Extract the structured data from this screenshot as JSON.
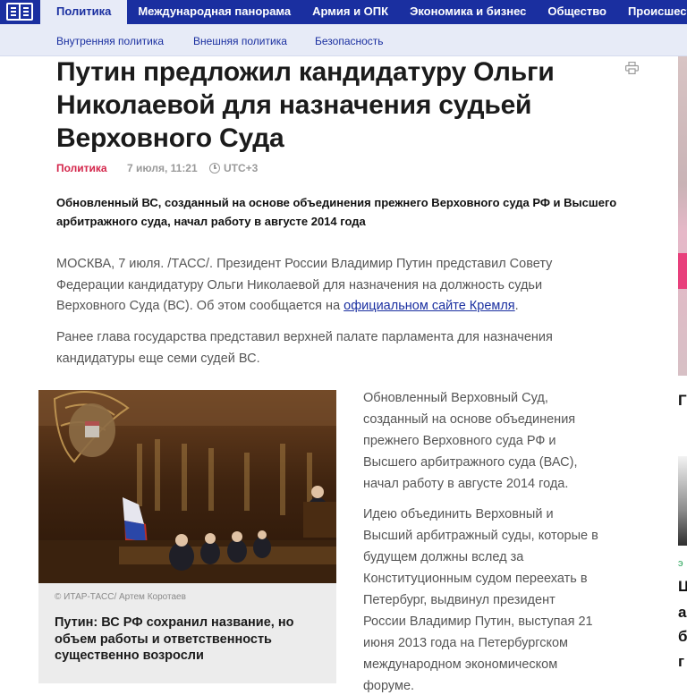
{
  "nav": {
    "items": [
      "Политика",
      "Международная панорама",
      "Армия и ОПК",
      "Экономика и бизнес",
      "Общество",
      "Происшествия"
    ],
    "active": "Политика"
  },
  "subnav": {
    "items": [
      "Внутренняя политика",
      "Внешняя политика",
      "Безопасность"
    ]
  },
  "article": {
    "title": "Путин предложил кандидатуру Ольги Николаевой для назначения судьей Верховного Суда",
    "rubric": "Политика",
    "date": "7 июля, 11:21",
    "timezone": "UTC+3",
    "lead": "Обновленный ВС, созданный на основе объединения прежнего Верховного суда РФ и Высшего арбитражного суда, начал работу в августе 2014 года",
    "p1_start": "МОСКВА, 7 июля. /ТАСС/. Президент России Владимир Путин представил Совету Федерации кандидатуру Ольги Николаевой для назначения на должность судьи Верховного Суда (ВС). Об этом сообщается на ",
    "p1_link": "официальном сайте Кремля",
    "p1_end": ".",
    "p2": "Ранее глава государства представил верхней палате парламента для назначения кандидатуры еще семи судей ВС.",
    "side_p1": "Обновленный Верховный Суд, созданный на основе объединения прежнего Верховного суда РФ и Высшего арбитражного суда (ВАС), начал работу в августе 2014 года.",
    "side_p2": "Идею объединить Верховный и Высший арбитражный суды, которые в будущем должны вслед за Конституционным судом переехать в Петербург, выдвинул президент России Владимир Путин, выступая 21 июня 2013 года на Петербургском международном экономическом форуме."
  },
  "related": {
    "credit": "© ИТАР-ТАСС/ Артем Коротаев",
    "title": "Путин: ВС РФ сохранил название, но объем работы и ответственность существенно возросли"
  },
  "right_column": {
    "chars": [
      "Г",
      "Ц",
      "а",
      "б",
      "г"
    ],
    "green": "э"
  },
  "icons": {
    "logo": "tass-book-logo",
    "print": "printer-icon",
    "clock": "clock-icon"
  },
  "colors": {
    "nav_bg": "#1a2fa0",
    "subnav_bg": "#e7ebf7",
    "rubric": "#d4264b"
  }
}
